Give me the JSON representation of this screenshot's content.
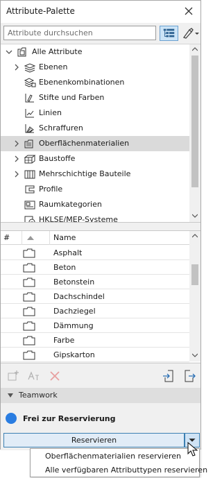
{
  "window": {
    "title": "Attribute-Palette"
  },
  "search": {
    "placeholder": "Attribute durchsuchen",
    "value": ""
  },
  "tree": {
    "root": "Alle Attribute",
    "items": [
      {
        "label": "Ebenen",
        "icon": "layers-icon",
        "expandable": true
      },
      {
        "label": "Ebenenkombinationen",
        "icon": "layer-combination-icon",
        "expandable": false
      },
      {
        "label": "Stifte und Farben",
        "icon": "pen-icon",
        "expandable": false
      },
      {
        "label": "Linien",
        "icon": "line-type-icon",
        "expandable": false
      },
      {
        "label": "Schraffuren",
        "icon": "fill-icon",
        "expandable": false
      },
      {
        "label": "Oberflächenmaterialien",
        "icon": "surface-icon",
        "expandable": true,
        "selected": true
      },
      {
        "label": "Baustoffe",
        "icon": "building-material-icon",
        "expandable": true
      },
      {
        "label": "Mehrschichtige Bauteile",
        "icon": "composite-icon",
        "expandable": true
      },
      {
        "label": "Profile",
        "icon": "profile-icon",
        "expandable": false
      },
      {
        "label": "Raumkategorien",
        "icon": "zone-category-icon",
        "expandable": false
      },
      {
        "label": "HKLSE/MEP-Systeme",
        "icon": "mep-system-icon",
        "expandable": false
      }
    ]
  },
  "list": {
    "columns": {
      "hash": "#",
      "name": "Name"
    },
    "rows": [
      "Asphalt",
      "Beton",
      "Betonstein",
      "Dachschindel",
      "Dachziegel",
      "Dämmung",
      "Farbe",
      "Gipskarton"
    ]
  },
  "teamwork": {
    "section_title": "Teamwork",
    "status": "Frei zur Reservierung",
    "status_color": "#2a7de1",
    "reserve_label": "Reservieren"
  },
  "dropdown": {
    "items": [
      "Oberflächenmaterialien reservieren",
      "Alle verfügbaren Attributtypen reservieren"
    ]
  },
  "colors": {
    "selection": "#dadada",
    "accent": "#3c7fb1",
    "button_bg": "#e1ecf7"
  }
}
